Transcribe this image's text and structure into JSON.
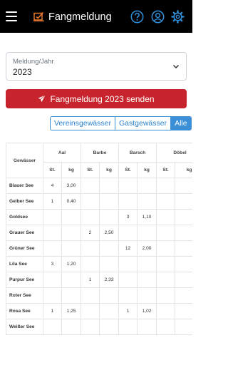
{
  "header": {
    "title": "Fangmeldung",
    "icons": [
      "menu-icon",
      "report-icon",
      "help-icon",
      "user-icon",
      "settings-icon"
    ],
    "accent": "#2f8fd8",
    "brand_icon_color": "#e8782a"
  },
  "year_select": {
    "label": "Meldung/Jahr",
    "value": "2023"
  },
  "send_button": {
    "label": "Fangmeldung 2023 senden",
    "color": "#c8242d"
  },
  "filters": {
    "items": [
      "Vereinsgewässer",
      "Gastgewässer",
      "Alle"
    ],
    "active": "Alle"
  },
  "table": {
    "water_header": "Gewässer",
    "fish": [
      "Aal",
      "Barbe",
      "Barsch",
      "Döbel"
    ],
    "sub_st": "St.",
    "sub_kg": "kg",
    "rows": [
      {
        "name": "Blauer See",
        "c": [
          "4",
          "3,00",
          "",
          "",
          "",
          "",
          "",
          ""
        ]
      },
      {
        "name": "Gelber See",
        "c": [
          "1",
          "0,40",
          "",
          "",
          "",
          "",
          "",
          ""
        ]
      },
      {
        "name": "Goldsee",
        "c": [
          "",
          "",
          "",
          "",
          "3",
          "1,10",
          "",
          ""
        ]
      },
      {
        "name": "Grauer See",
        "c": [
          "",
          "",
          "2",
          "2,50",
          "",
          "",
          "",
          ""
        ]
      },
      {
        "name": "Grüner See",
        "c": [
          "",
          "",
          "",
          "",
          "12",
          "2,00",
          "",
          ""
        ]
      },
      {
        "name": "Lila See",
        "c": [
          "3",
          "1,20",
          "",
          "",
          "",
          "",
          "",
          ""
        ]
      },
      {
        "name": "Purpur See",
        "c": [
          "",
          "",
          "1",
          "2,33",
          "",
          "",
          "",
          ""
        ]
      },
      {
        "name": "Roter See",
        "c": [
          "",
          "",
          "",
          "",
          "",
          "",
          "",
          ""
        ]
      },
      {
        "name": "Rosa See",
        "c": [
          "1",
          "1,25",
          "",
          "",
          "1",
          "1,02",
          "",
          ""
        ]
      },
      {
        "name": "Weißer See",
        "c": [
          "",
          "",
          "",
          "",
          "",
          "",
          "",
          ""
        ]
      }
    ]
  }
}
